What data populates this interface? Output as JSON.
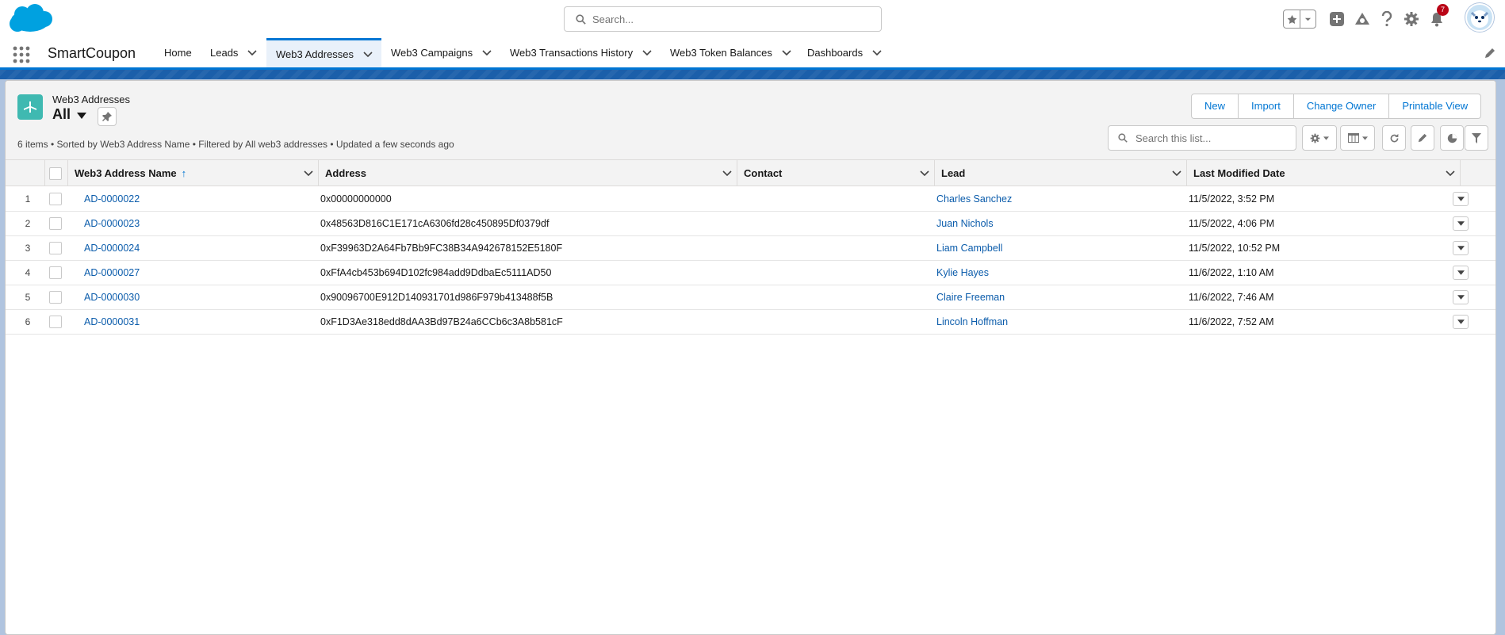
{
  "header": {
    "search_placeholder": "Search...",
    "notification_count": "7"
  },
  "nav": {
    "app_name": "SmartCoupon",
    "items": [
      {
        "label": "Home"
      },
      {
        "label": "Leads"
      },
      {
        "label": "Web3 Addresses"
      },
      {
        "label": "Web3 Campaigns"
      },
      {
        "label": "Web3 Transactions History"
      },
      {
        "label": "Web3 Token Balances"
      },
      {
        "label": "Dashboards"
      }
    ]
  },
  "list_view": {
    "object_label": "Web3 Addresses",
    "view_name": "All",
    "info": "6 items • Sorted by Web3 Address Name • Filtered by All web3 addresses • Updated a few seconds ago",
    "actions": [
      "New",
      "Import",
      "Change Owner",
      "Printable View"
    ],
    "search_placeholder": "Search this list..."
  },
  "table": {
    "columns": [
      "Web3 Address Name",
      "Address",
      "Contact",
      "Lead",
      "Last Modified Date"
    ],
    "rows": [
      {
        "num": "1",
        "name": "AD-0000022",
        "address": "0x00000000000",
        "contact": "",
        "lead": "Charles Sanchez",
        "modified": "11/5/2022, 3:52 PM"
      },
      {
        "num": "2",
        "name": "AD-0000023",
        "address": "0x48563D816C1E171cA6306fd28c450895Df0379df",
        "contact": "",
        "lead": "Juan Nichols",
        "modified": "11/5/2022, 4:06 PM"
      },
      {
        "num": "3",
        "name": "AD-0000024",
        "address": "0xF39963D2A64Fb7Bb9FC38B34A942678152E5180F",
        "contact": "",
        "lead": "Liam Campbell",
        "modified": "11/5/2022, 10:52 PM"
      },
      {
        "num": "4",
        "name": "AD-0000027",
        "address": "0xFfA4cb453b694D102fc984add9DdbaEc5111AD50",
        "contact": "",
        "lead": "Kylie Hayes",
        "modified": "11/6/2022, 1:10 AM"
      },
      {
        "num": "5",
        "name": "AD-0000030",
        "address": "0x90096700E912D140931701d986F979b413488f5B",
        "contact": "",
        "lead": "Claire Freeman",
        "modified": "11/6/2022, 7:46 AM"
      },
      {
        "num": "6",
        "name": "AD-0000031",
        "address": "0xF1D3Ae318edd8dAA3Bd97B24a6CCb6c3A8b581cF",
        "contact": "",
        "lead": "Lincoln Hoffman",
        "modified": "11/6/2022, 7:52 AM"
      }
    ]
  },
  "colors": {
    "brand": "#0176d3",
    "link": "#0b5cab",
    "object_icon": "#3fb9b1",
    "band": "#1b5faa"
  }
}
